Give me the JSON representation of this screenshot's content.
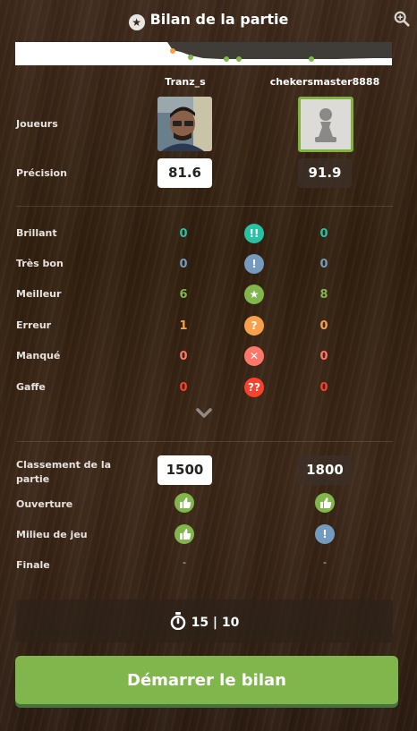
{
  "header": {
    "title": "Bilan de la partie",
    "title_icon": "star-icon",
    "action_icon": "zoom-icon"
  },
  "players": {
    "white": {
      "name": "Tranz_s"
    },
    "black": {
      "name": "chekersmaster8888"
    }
  },
  "labels": {
    "players": "Joueurs",
    "accuracy": "Précision",
    "game_rating": "Classement de la partie",
    "opening": "Ouverture",
    "middlegame": "Milieu de jeu",
    "endgame": "Finale"
  },
  "accuracy": {
    "white": "81.6",
    "black": "91.9"
  },
  "classifications": [
    {
      "label": "Brillant",
      "white": "0",
      "black": "0",
      "color": "#26c2a3",
      "icon_color": "#26c2a3",
      "glyph": "!!",
      "icon": "brilliant-icon"
    },
    {
      "label": "Très bon",
      "white": "0",
      "black": "0",
      "color": "#749bbf",
      "icon_color": "#749bbf",
      "glyph": "!",
      "icon": "great-move-icon"
    },
    {
      "label": "Meilleur",
      "white": "6",
      "black": "8",
      "color": "#81b64c",
      "icon_color": "#81b64c",
      "glyph": "★",
      "icon": "best-move-icon"
    },
    {
      "label": "Erreur",
      "white": "1",
      "black": "0",
      "color": "#f7a04c",
      "icon_color": "#f7a04c",
      "glyph": "?",
      "icon": "mistake-icon"
    },
    {
      "label": "Manqué",
      "white": "0",
      "black": "0",
      "color": "#ff7769",
      "icon_color": "#ff7769",
      "glyph": "✕",
      "icon": "miss-icon"
    },
    {
      "label": "Gaffe",
      "white": "0",
      "black": "0",
      "color": "#fa412d",
      "icon_color": "#fa412d",
      "glyph": "??",
      "icon": "blunder-icon"
    }
  ],
  "expand_icon": "chevron-down-icon",
  "ratings": {
    "white": "1500",
    "black": "1800"
  },
  "phases": {
    "opening": {
      "white": "good-icon",
      "black": "good-icon"
    },
    "middlegame": {
      "white": "good-icon",
      "black": "great-icon"
    },
    "endgame": {
      "white": "-",
      "black": "-"
    }
  },
  "time_control": {
    "icon": "stopwatch-icon",
    "text": "15 | 10"
  },
  "start_button": "Démarrer le bilan",
  "colors": {
    "accent": "#81b64c",
    "accent_shadow": "#45753c",
    "brilliant": "#26c2a3",
    "great": "#749bbf",
    "mistake": "#f7a04c",
    "miss": "#ff7769",
    "blunder": "#fa412d"
  }
}
